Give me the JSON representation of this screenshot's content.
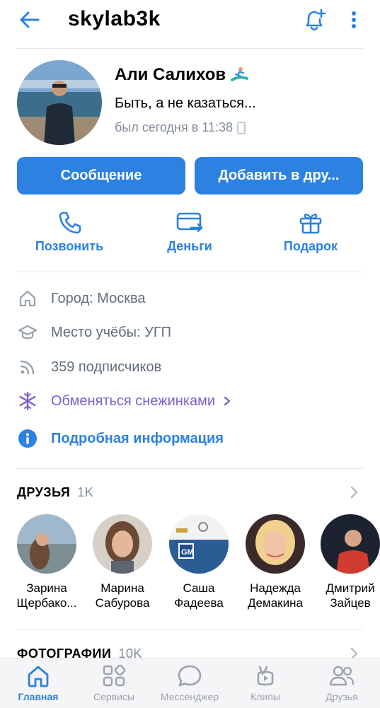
{
  "topbar": {
    "title": "skylab3k"
  },
  "profile": {
    "name": "Али Салихов",
    "status": "Быть, а не казаться...",
    "last_seen": "был сегодня в 11:38"
  },
  "buttons": {
    "message": "Сообщение",
    "add_friend": "Добавить в дру..."
  },
  "actions": [
    {
      "label": "Позвонить",
      "icon": "phone-icon"
    },
    {
      "label": "Деньги",
      "icon": "money-transfer-icon"
    },
    {
      "label": "Подарок",
      "icon": "gift-icon"
    }
  ],
  "info": {
    "city": "Город: Москва",
    "study": "Место учёбы: УГП",
    "followers": "359 подписчиков",
    "snowflakes": "Обменяться снежинками",
    "details": "Подробная информация"
  },
  "friends_section": {
    "title": "ДРУЗЬЯ",
    "count": "1K",
    "friends": [
      {
        "first": "Зарина",
        "last": "Щербако..."
      },
      {
        "first": "Марина",
        "last": "Сабурова"
      },
      {
        "first": "Саша",
        "last": "Фадеева"
      },
      {
        "first": "Надежда",
        "last": "Демакина"
      },
      {
        "first": "Дмитрий",
        "last": "Зайцев"
      }
    ]
  },
  "photos_section": {
    "title": "ФОТОГРАФИИ",
    "count": "10K"
  },
  "bottom_nav": [
    {
      "label": "Главная",
      "icon": "home-icon",
      "active": true
    },
    {
      "label": "Сервисы",
      "icon": "services-icon",
      "active": false
    },
    {
      "label": "Мессенджер",
      "icon": "messenger-icon",
      "active": false
    },
    {
      "label": "Клипы",
      "icon": "clips-icon",
      "active": false
    },
    {
      "label": "Друзья",
      "icon": "friends-icon",
      "active": false
    }
  ],
  "colors": {
    "accent": "#2d81e0",
    "purple": "#7b5fd1",
    "secondary_text": "#818c99"
  }
}
